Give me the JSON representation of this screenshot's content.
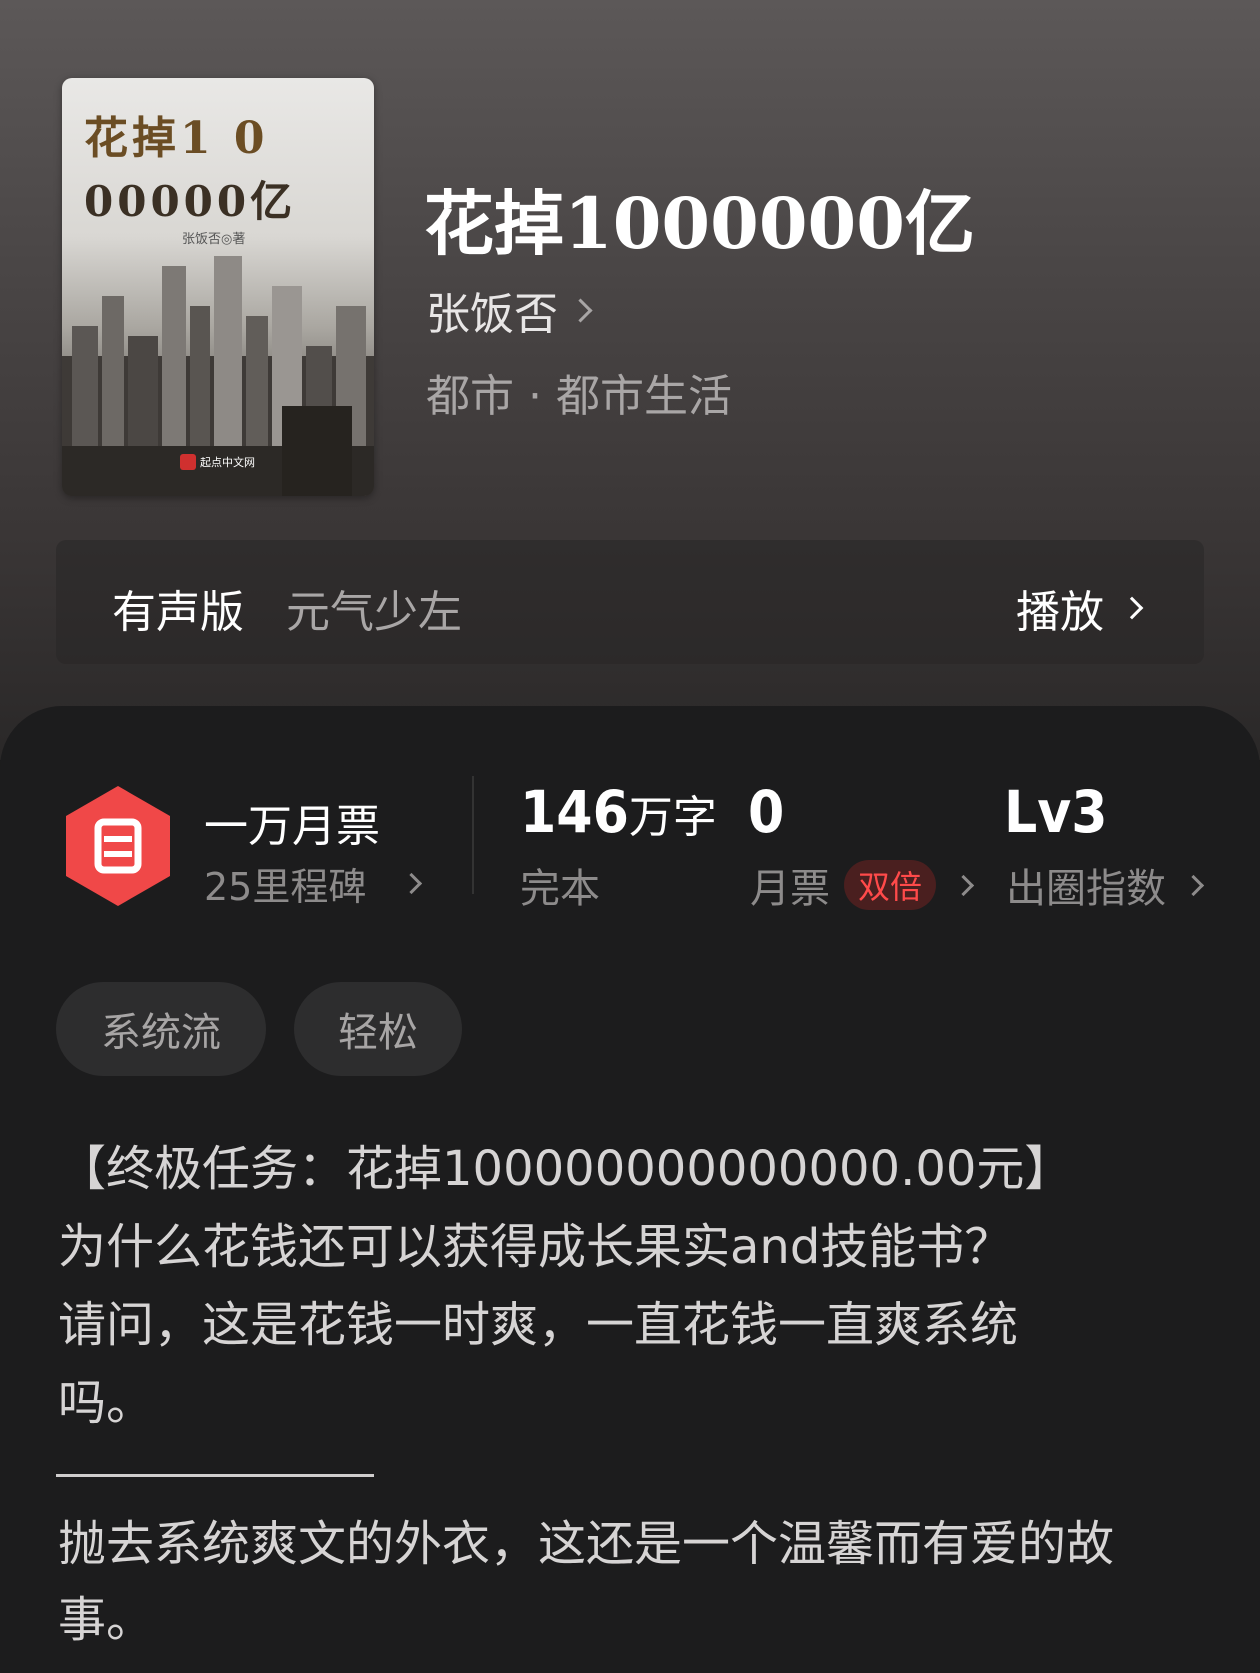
{
  "cover": {
    "title_line1": "花掉1 0",
    "title_line2": "00000亿",
    "author": "张饭否◎著",
    "publisher": "起点中文网"
  },
  "book": {
    "title": "花掉1000000亿",
    "author": "张饭否",
    "genre": "都市 · 都市生活"
  },
  "audio": {
    "label": "有声版",
    "narrator": "元气少左",
    "play_label": "播放"
  },
  "stats": {
    "ticket_title": "一万月票",
    "ticket_sub": "25里程碑",
    "word_count": "146",
    "word_unit": "万字",
    "status": "完本",
    "monthly_votes": "0",
    "monthly_label": "月票",
    "double_badge": "双倍",
    "level": "Lv3",
    "level_label": "出圈指数"
  },
  "tags": [
    "系统流",
    "轻松"
  ],
  "description": {
    "lines": [
      "【终极任务：花掉100000000000000.00元】",
      "为什么花钱还可以获得成长果实and技能书？",
      "请问，这是花钱一时爽，一直花钱一直爽系统",
      "吗。"
    ],
    "after_divider": "抛去系统爽文的外衣，这还是一个温馨而有爱的故事。"
  },
  "colors": {
    "accent_red": "#f04848",
    "badge_red": "#ff4a4a"
  }
}
